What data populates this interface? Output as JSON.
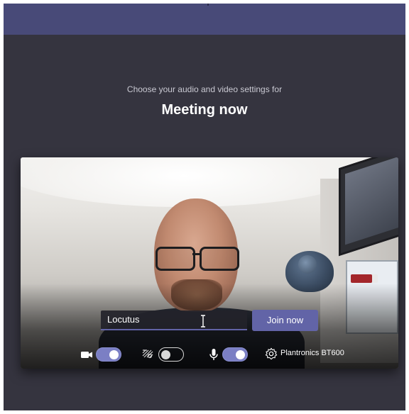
{
  "prejoin": {
    "subtitle": "Choose your audio and video settings for",
    "meeting_title": "Meeting now"
  },
  "name_input": {
    "value": "Locutus"
  },
  "join_button": {
    "label": "Join now"
  },
  "controls": {
    "camera": {
      "icon": "video-camera-icon",
      "state": "on"
    },
    "background_effects": {
      "icon": "background-blur-icon",
      "state": "off"
    },
    "microphone": {
      "icon": "microphone-icon",
      "state": "on"
    },
    "device_settings": {
      "icon": "gear-icon",
      "label": "Plantronics BT600"
    }
  },
  "colors": {
    "accent": "#6264a7",
    "topbar": "#484a78",
    "background": "#35343f"
  }
}
